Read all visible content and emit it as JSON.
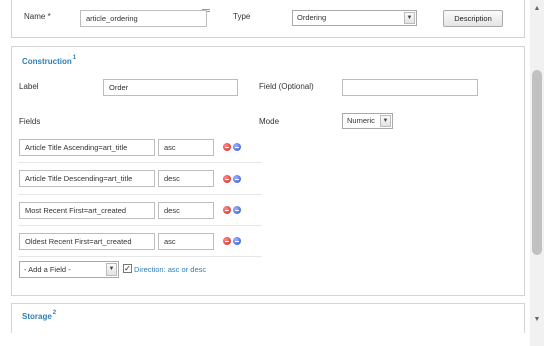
{
  "top": {
    "name_label": "Name",
    "required_mark": "*",
    "name_value": "article_ordering",
    "type_label": "Type",
    "type_value": "Ordering",
    "description_button": "Description"
  },
  "construction": {
    "title": "Construction",
    "title_sup": "1",
    "label_label": "Label",
    "label_value": "Order",
    "field_optional_label": "Field (Optional)",
    "field_optional_value": "",
    "fields_label": "Fields",
    "mode_label": "Mode",
    "mode_value": "Numeric",
    "rows": [
      {
        "field": "Article Title Ascending=art_title",
        "dir": "asc"
      },
      {
        "field": "Article Title Descending=art_title",
        "dir": "desc"
      },
      {
        "field": "Most Recent First=art_created",
        "dir": "desc"
      },
      {
        "field": "Oldest Recent First=art_created",
        "dir": "asc"
      }
    ],
    "add_field_value": "- Add a Field -",
    "direction_checked": true,
    "direction_link": "Direction: asc or desc"
  },
  "storage": {
    "title": "Storage",
    "title_sup": "2"
  },
  "colors": {
    "accent": "#2d7fb8",
    "border": "#d4d4d4",
    "delete_icon": "#d22020",
    "add_icon": "#2f4fd2"
  },
  "icons": [
    "minus-circle-red-icon",
    "plus-circle-blue-icon",
    "select-arrow-icon",
    "scroll-up-icon",
    "scroll-down-icon"
  ]
}
